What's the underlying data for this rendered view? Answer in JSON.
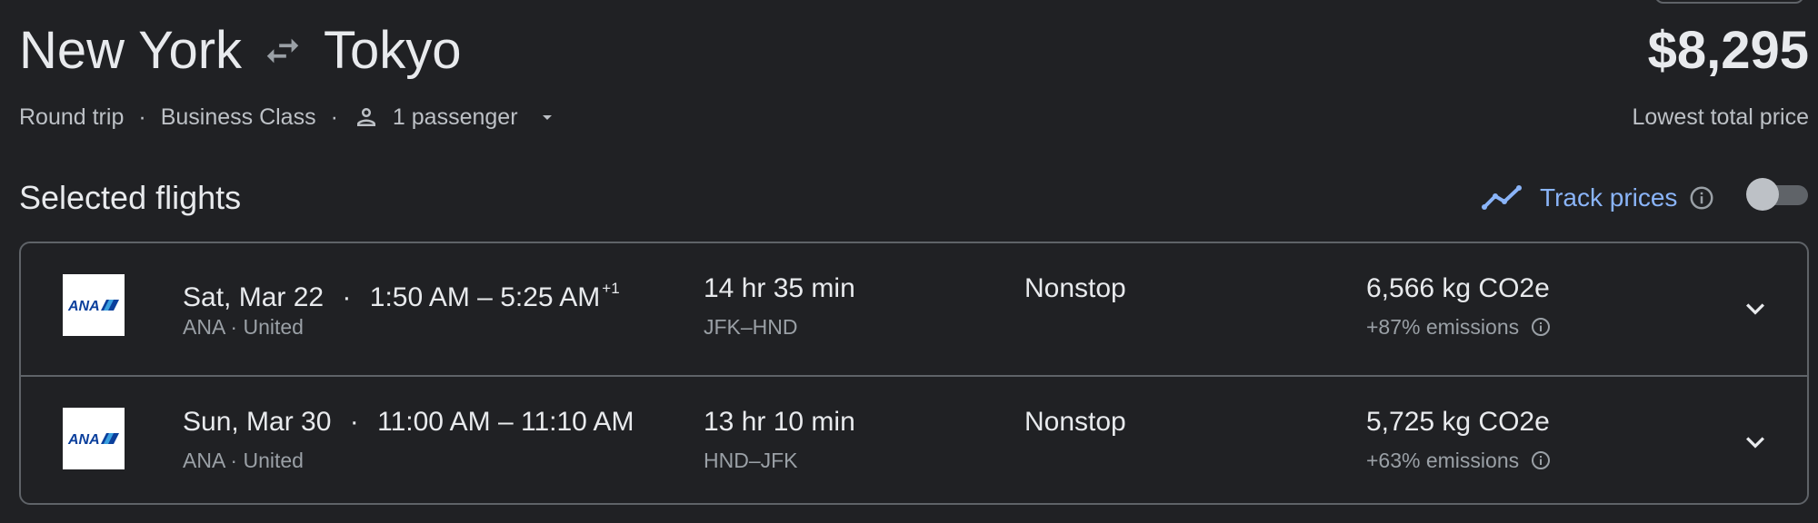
{
  "header": {
    "origin": "New York",
    "destination": "Tokyo",
    "swap_icon": "swap-arrows-icon",
    "price": "$8,295",
    "price_caption": "Lowest total price"
  },
  "trip": {
    "type": "Round trip",
    "separator": "·",
    "cabin": "Business Class",
    "passengers": "1 passenger"
  },
  "section": {
    "title": "Selected flights",
    "track_label": "Track prices",
    "track_toggle_on": false
  },
  "flights": [
    {
      "date": "Sat, Mar 22",
      "times": "1:50 AM – 5:25 AM",
      "day_offset": "+1",
      "airlines": "ANA · United",
      "duration": "14 hr 35 min",
      "route": "JFK–HND",
      "stops": "Nonstop",
      "co2": "6,566 kg CO2e",
      "emissions": "+87% emissions"
    },
    {
      "date": "Sun, Mar 30",
      "times": "11:00 AM – 11:10 AM",
      "day_offset": "",
      "airlines": "ANA · United",
      "duration": "13 hr 10 min",
      "route": "HND–JFK",
      "stops": "Nonstop",
      "co2": "5,725 kg CO2e",
      "emissions": "+63% emissions"
    }
  ],
  "colors": {
    "background": "#202124",
    "accent": "#8ab4f8",
    "border": "#5f6368",
    "logo_blue": "#0b3f9c"
  }
}
